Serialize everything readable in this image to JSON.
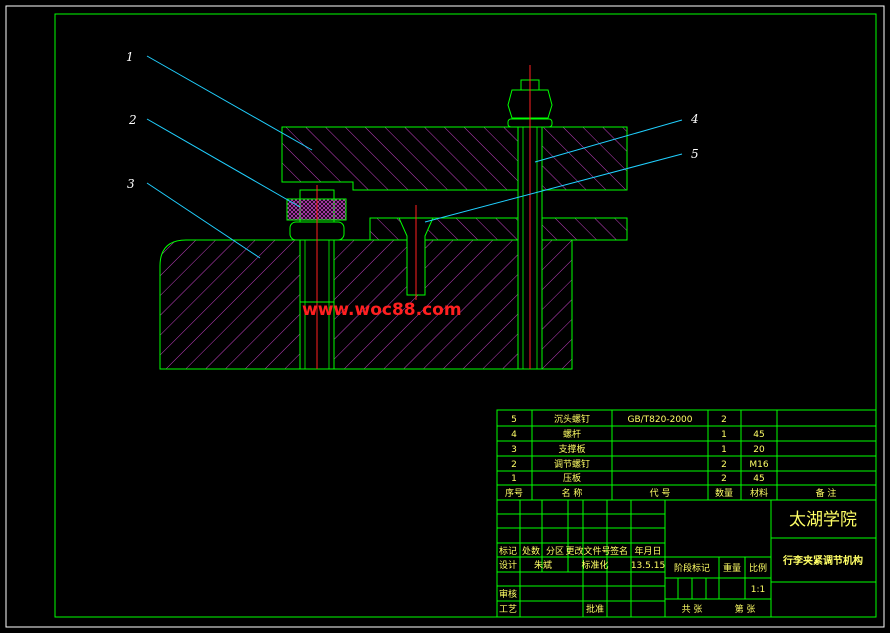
{
  "watermark": "www.woc88.com",
  "callouts": [
    "1",
    "2",
    "3",
    "4",
    "5"
  ],
  "parts": [
    {
      "no": "5",
      "name": "沉头螺钉",
      "code": "GB/T820-2000",
      "qty": "2",
      "material": "",
      "note": ""
    },
    {
      "no": "4",
      "name": "螺杆",
      "code": "",
      "qty": "1",
      "material": "45",
      "note": ""
    },
    {
      "no": "3",
      "name": "支撑板",
      "code": "",
      "qty": "1",
      "material": "20",
      "note": ""
    },
    {
      "no": "2",
      "name": "调节螺钉",
      "code": "",
      "qty": "2",
      "material": "M16",
      "note": ""
    },
    {
      "no": "1",
      "name": "压板",
      "code": "",
      "qty": "2",
      "material": "45",
      "note": ""
    }
  ],
  "parts_header": {
    "no": "序号",
    "name": "名 称",
    "code": "代 号",
    "qty": "数量",
    "material": "材料",
    "note": "备 注"
  },
  "title_block": {
    "school": "太湖学院",
    "drawing_title": "行李夹紧调节机构",
    "rev_headers": [
      "标记",
      "处数",
      "分区",
      "更改文件号",
      "签名",
      "年月日"
    ],
    "design_label": "设计",
    "designer": "朱斌",
    "standard_label": "标准化",
    "date": "13.5.15",
    "stage_label": "阶段标记",
    "weight_label": "重量",
    "scale_label": "比例",
    "scale": "1:1",
    "review_label": "审核",
    "process_label": "工艺",
    "approve_label": "批准",
    "sheets_label": "共 张",
    "sheet_label": "第 张"
  }
}
